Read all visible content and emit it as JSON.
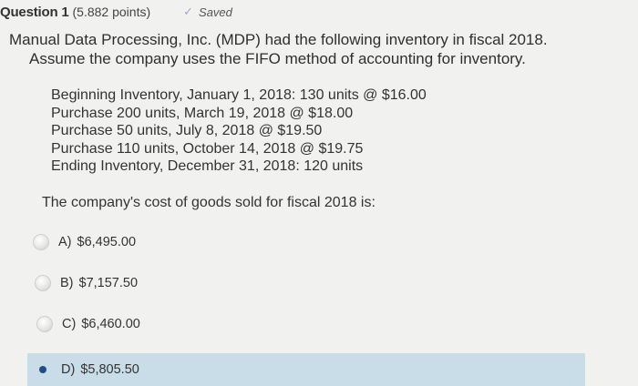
{
  "header": {
    "question_title": "Question 1",
    "points": "(5.882 points)",
    "saved_label": "Saved",
    "saved_icon": "check-icon"
  },
  "prompt": {
    "line1": "Manual Data Processing, Inc. (MDP) had the following inventory in fiscal 2018.",
    "line2": "Assume the company uses the FIFO method of accounting for inventory."
  },
  "details": [
    "Beginning Inventory, January 1, 2018: 130 units @ $16.00",
    "Purchase 200 units, March 19, 2018 @ $18.00",
    "Purchase 50 units, July 8, 2018 @ $19.50",
    "Purchase 110 units, October 14, 2018 @ $19.75",
    "Ending Inventory, December 31, 2018: 120 units"
  ],
  "question": "The company's cost of goods sold for fiscal 2018 is:",
  "options": [
    {
      "letter": "A)",
      "text": "$6,495.00",
      "selected": false
    },
    {
      "letter": "B)",
      "text": "$7,157.50",
      "selected": false
    },
    {
      "letter": "C)",
      "text": "$6,460.00",
      "selected": false
    },
    {
      "letter": "D)",
      "text": "$5,805.50",
      "selected": true
    }
  ]
}
